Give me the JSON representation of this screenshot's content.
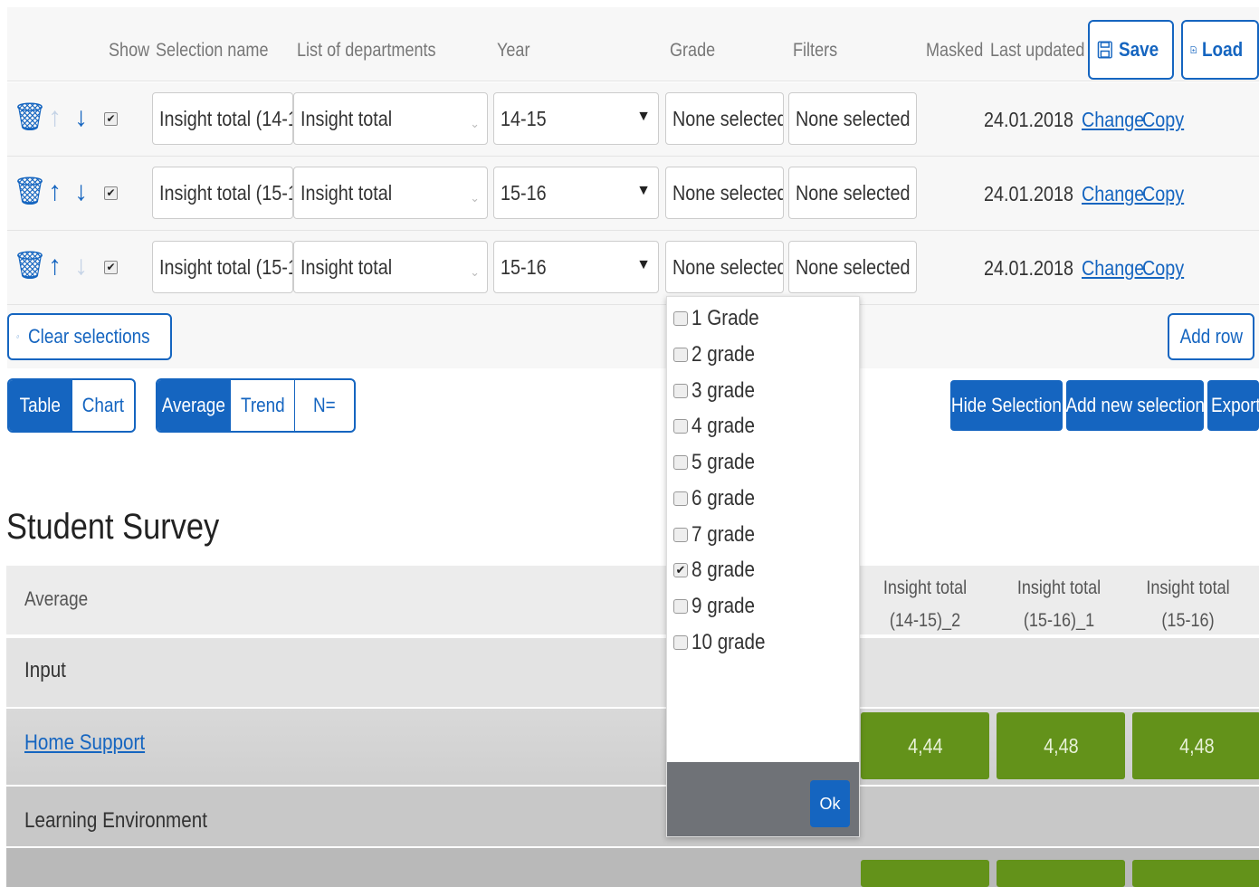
{
  "header": {
    "cols": {
      "show": "Show",
      "selection_name": "Selection name",
      "list_of_departments": "List of departments",
      "year": "Year",
      "grade": "Grade",
      "filters": "Filters",
      "masked": "Masked",
      "last_updated": "Last updated"
    },
    "save_label": "Save",
    "load_label": "Load"
  },
  "rows": [
    {
      "selection_name": "Insight total (14-1",
      "department": "Insight total",
      "year": "14-15",
      "grade": "None selected",
      "filters": "None selected",
      "last_updated": "24.01.2018",
      "change_label": "Change",
      "copy_label": "Copy"
    },
    {
      "selection_name": "Insight total (15-1",
      "department": "Insight total",
      "year": "15-16",
      "grade": "None selected",
      "filters": "None selected",
      "last_updated": "24.01.2018",
      "change_label": "Change",
      "copy_label": "Copy"
    },
    {
      "selection_name": "Insight total (15-1",
      "department": "Insight total",
      "year": "15-16",
      "grade": "None selected",
      "filters": "None selected",
      "last_updated": "24.01.2018",
      "change_label": "Change",
      "copy_label": "Copy"
    }
  ],
  "actions": {
    "clear_selections": "Clear selections",
    "add_row": "Add row",
    "hide_selection": "Hide Selection",
    "add_new_selection": "Add new selection",
    "export": "Export"
  },
  "view_toggle": {
    "table": "Table",
    "chart": "Chart",
    "selected": "Table"
  },
  "metric_toggle": {
    "average": "Average",
    "trend": "Trend",
    "n": "N=",
    "selected": "Average"
  },
  "survey": {
    "title": "Student Survey",
    "table": {
      "first_col_header": "Average",
      "columns": [
        "Insight total (14-15)_2",
        "Insight total (15-16)_1",
        "Insight total (15-16)"
      ],
      "sections": [
        {
          "name": "Input"
        },
        {
          "name": "Home Support",
          "is_link": true,
          "values": [
            "4,44",
            "4,48",
            "4,48"
          ]
        },
        {
          "name": "Learning Environment"
        }
      ]
    }
  },
  "grade_dropdown": {
    "options": [
      {
        "label": "1 Grade",
        "checked": false
      },
      {
        "label": "2 grade",
        "checked": false
      },
      {
        "label": "3 grade",
        "checked": false
      },
      {
        "label": "4 grade",
        "checked": false
      },
      {
        "label": "5 grade",
        "checked": false
      },
      {
        "label": "6 grade",
        "checked": false
      },
      {
        "label": "7 grade",
        "checked": false
      },
      {
        "label": "8 grade",
        "checked": true
      },
      {
        "label": "9 grade",
        "checked": false
      },
      {
        "label": "10 grade",
        "checked": false
      }
    ],
    "ok_label": "Ok"
  },
  "colors": {
    "accent": "#1565c0",
    "good_score": "#63921a",
    "panel_bg": "#f7f7f7"
  }
}
